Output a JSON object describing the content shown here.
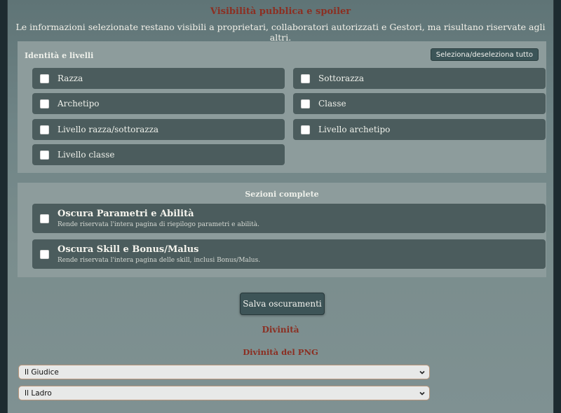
{
  "visibility": {
    "title": "Visibilità pubblica e spoiler",
    "subtitle": "Le informazioni selezionate restano visibili a proprietari, collaboratori autorizzati e Gestori, ma risultano riservate agli altri."
  },
  "identity_panel": {
    "label": "Identità e livelli",
    "toggle_all_label": "Seleziona/deseleziona tutto",
    "options": [
      {
        "label": "Razza",
        "checked": false
      },
      {
        "label": "Sottorazza",
        "checked": false
      },
      {
        "label": "Archetipo",
        "checked": false
      },
      {
        "label": "Classe",
        "checked": false
      },
      {
        "label": "Livello razza/sottorazza",
        "checked": false
      },
      {
        "label": "Livello archetipo",
        "checked": false
      },
      {
        "label": "Livello classe",
        "checked": false
      }
    ]
  },
  "sections_panel": {
    "label": "Sezioni complete",
    "options": [
      {
        "title": "Oscura Parametri e Abilità",
        "description": "Rende riservata l'intera pagina di riepilogo parametri e abilità.",
        "checked": false
      },
      {
        "title": "Oscura Skill e Bonus/Malus",
        "description": "Rende riservata l'intera pagina delle skill, inclusi Bonus/Malus.",
        "checked": false
      }
    ]
  },
  "save_button_label": "Salva oscuramenti",
  "divinity": {
    "title": "Divinità",
    "subtitle": "Divinità del PNG",
    "selects": [
      {
        "value": "Il Giudice"
      },
      {
        "value": "Il Ladro"
      }
    ]
  },
  "icons": {
    "checkbox": "checkbox-icon",
    "dropdown": "chevron-down-icon"
  },
  "colors": {
    "accent_title": "#8b2f22",
    "option_bg": "#4b5c5d",
    "panel_bg": "#8d9c9c",
    "button_bg": "#3d5457"
  }
}
